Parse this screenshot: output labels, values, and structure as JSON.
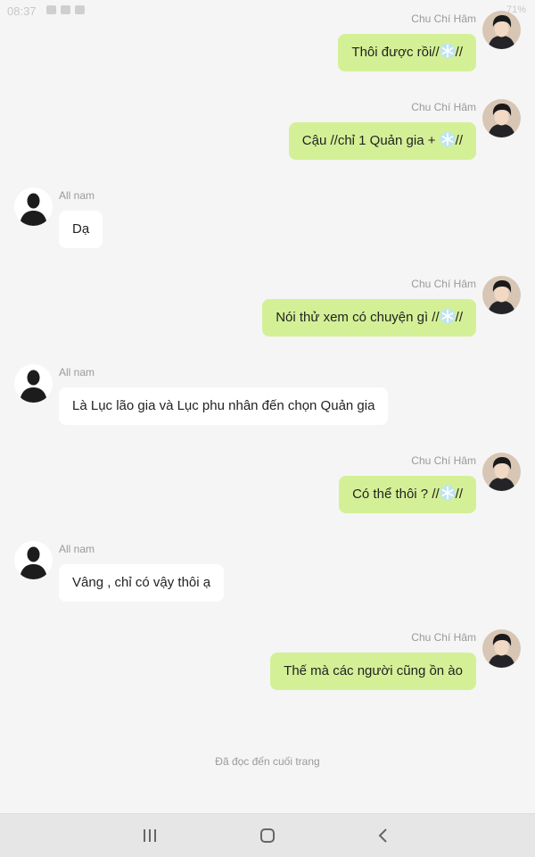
{
  "status_bar": {
    "time": "08:37",
    "right": "71%"
  },
  "footer_text": "Đã đọc đến cuối trang",
  "messages": [
    {
      "side": "right",
      "sender": "Chu Chí Hâm",
      "text_before": "Thôi được rồi//",
      "icon": "snowflake-icon",
      "text_after": "//"
    },
    {
      "side": "right",
      "sender": "Chu Chí Hâm",
      "text_before": "Cậu //chỉ 1 Quản gia + ",
      "icon": "snowflake-icon",
      "text_after": "//"
    },
    {
      "side": "left",
      "sender": "All nam",
      "text_before": "Dạ"
    },
    {
      "side": "right",
      "sender": "Chu Chí Hâm",
      "text_before": "Nói thử xem có chuyện gì //",
      "icon": "snowflake-icon",
      "text_after": "//"
    },
    {
      "side": "left",
      "sender": "All nam",
      "text_before": "Là Lục lão gia và Lục phu nhân đến chọn Quản gia"
    },
    {
      "side": "right",
      "sender": "Chu Chí Hâm",
      "text_before": "Có thể thôi ? //",
      "icon": "snowflake-icon",
      "text_after": "//"
    },
    {
      "side": "left",
      "sender": "All nam",
      "text_before": "Vâng , chỉ có vậy thôi ạ"
    },
    {
      "side": "right",
      "sender": "Chu Chí Hâm",
      "text_before": "Thế mà các người cũng ồn ào"
    }
  ],
  "colors": {
    "right_bubble": "#d4f096",
    "left_bubble": "#ffffff",
    "background": "#f5f5f5"
  }
}
